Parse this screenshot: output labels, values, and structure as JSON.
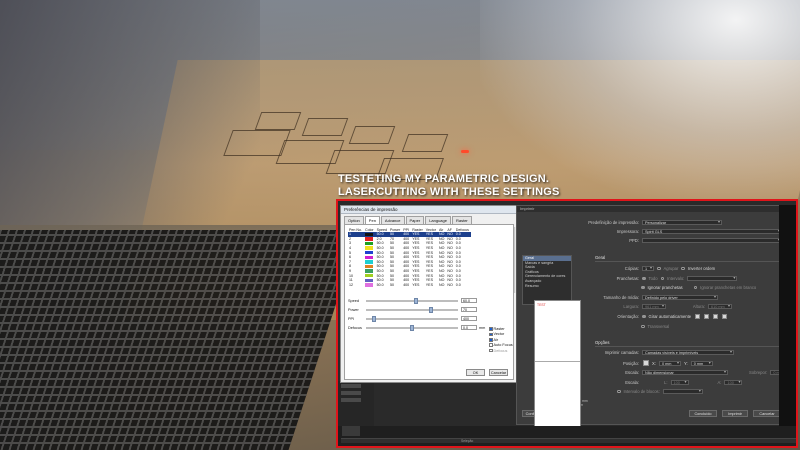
{
  "caption": {
    "line1": "TESTETING MY PARAMETRIC DESIGN.",
    "line2": "LASERCUTTING WITH THESE SETTINGS"
  },
  "prefs": {
    "title": "Preferências de impressão",
    "tabs": [
      "Option",
      "Pen",
      "Advance",
      "Paper",
      "Language",
      "Raster"
    ],
    "active_tab": "Pen",
    "columns": [
      "Pen No.",
      "Color",
      "Speed",
      "Power",
      "PPI",
      "Raster",
      "Vector",
      "Air",
      "AF",
      "Defocus"
    ],
    "pens": [
      {
        "no": "1",
        "color": "#111111",
        "speed": "50.0",
        "power": "50",
        "ppi": "400",
        "raster": "YES",
        "vector": "YES",
        "air": "NO",
        "af": "NO",
        "defocus": "0.0"
      },
      {
        "no": "2",
        "color": "#e02020",
        "speed": "2.0",
        "power": "70",
        "ppi": "400",
        "raster": "YES",
        "vector": "YES",
        "air": "NO",
        "af": "NO",
        "defocus": "0.0"
      },
      {
        "no": "3",
        "color": "#20a020",
        "speed": "50.0",
        "power": "50",
        "ppi": "400",
        "raster": "YES",
        "vector": "YES",
        "air": "NO",
        "af": "NO",
        "defocus": "0.0"
      },
      {
        "no": "4",
        "color": "#f0e020",
        "speed": "50.0",
        "power": "50",
        "ppi": "400",
        "raster": "YES",
        "vector": "YES",
        "air": "NO",
        "af": "NO",
        "defocus": "0.0"
      },
      {
        "no": "5",
        "color": "#2040d0",
        "speed": "50.0",
        "power": "50",
        "ppi": "400",
        "raster": "YES",
        "vector": "YES",
        "air": "NO",
        "af": "NO",
        "defocus": "0.0"
      },
      {
        "no": "6",
        "color": "#d020d0",
        "speed": "50.0",
        "power": "50",
        "ppi": "400",
        "raster": "YES",
        "vector": "YES",
        "air": "NO",
        "af": "NO",
        "defocus": "0.0"
      },
      {
        "no": "7",
        "color": "#20d0d0",
        "speed": "50.0",
        "power": "50",
        "ppi": "400",
        "raster": "YES",
        "vector": "YES",
        "air": "NO",
        "af": "NO",
        "defocus": "0.0"
      },
      {
        "no": "8",
        "color": "#e08020",
        "speed": "50.0",
        "power": "50",
        "ppi": "400",
        "raster": "YES",
        "vector": "YES",
        "air": "NO",
        "af": "NO",
        "defocus": "0.0"
      },
      {
        "no": "9",
        "color": "#3aa060",
        "speed": "50.0",
        "power": "50",
        "ppi": "400",
        "raster": "YES",
        "vector": "YES",
        "air": "NO",
        "af": "NO",
        "defocus": "0.0"
      },
      {
        "no": "10",
        "color": "#a0d020",
        "speed": "50.0",
        "power": "50",
        "ppi": "400",
        "raster": "YES",
        "vector": "YES",
        "air": "NO",
        "af": "NO",
        "defocus": "0.0"
      },
      {
        "no": "11",
        "color": "#6060c0",
        "speed": "50.0",
        "power": "50",
        "ppi": "400",
        "raster": "YES",
        "vector": "YES",
        "air": "NO",
        "af": "NO",
        "defocus": "0.0"
      },
      {
        "no": "12",
        "color": "#e070e0",
        "speed": "50.0",
        "power": "50",
        "ppi": "400",
        "raster": "YES",
        "vector": "YES",
        "air": "NO",
        "af": "NO",
        "defocus": "0.0"
      }
    ],
    "selected_pen": "1",
    "speed_label": "Speed",
    "speed_value": "60.0",
    "power_label": "Power",
    "power_value": "70",
    "ppi_label": "PPI",
    "ppi_value": "400",
    "defocus_label": "Defocus",
    "defocus_value": "0.0",
    "defocus_unit": "mm",
    "checks": [
      {
        "label": "Raster",
        "on": true
      },
      {
        "label": "Vector",
        "on": true
      },
      {
        "label": "Air",
        "on": true
      },
      {
        "label": "Auto Focus",
        "on": false
      },
      {
        "label": "Defocus",
        "on": false
      }
    ],
    "ok_label": "OK",
    "cancel_label": "Cancelar"
  },
  "print": {
    "title": "Imprimir",
    "preset_label": "Predefinição de impressão:",
    "preset_value": "Personalizar",
    "printer_label": "Impressora:",
    "printer_value": "Spirit GLS",
    "ppd_label": "PPD:",
    "categories": [
      "Geral",
      "Marcas e sangria",
      "Saída",
      "Gráficos",
      "Gerenciamento de cores",
      "Avançado",
      "Resumo"
    ],
    "active_category": "Geral",
    "section_geral": "Geral",
    "copies_label": "Cópias:",
    "copies_value": "1",
    "collate_label": "Agrupar",
    "reverse_label": "Inverter ordem",
    "artboards_label": "Pranchetas:",
    "all_label": "Todo",
    "interval_label": "Intervalo:",
    "ignore_artboards_label": "Ignorar pranchetas",
    "skip_blank_label": "Ignorar pranchetas em branco",
    "media_size_label": "Tamanho de mídia:",
    "media_size_value": "Definido pelo driver",
    "width_label": "Largura:",
    "width_value": "961 mm",
    "height_label": "Altura:",
    "height_value": "610 mm",
    "orientation_label": "Orientação:",
    "auto_rotate_label": "Girar automaticamente",
    "transverse_label": "Transversal",
    "section_options": "Opções",
    "print_layers_label": "Imprimir camadas:",
    "print_layers_value": "Camadas visíveis e imprimíveis",
    "position_label": "Posição:",
    "position_x_value": "0 mm",
    "position_y_value": "0 mm",
    "scaling_label": "Escala:",
    "scaling_value": "Não dimensionar",
    "overlap_label": "Sobrepor:",
    "overlap_value": "0 mm",
    "scale_label": "Escala:",
    "scale_w_value": "100",
    "scale_h_value": "100",
    "tile_range_label": "Intervalo de blocos:",
    "preview_tag": "TEST",
    "pager_value": "1 de 1",
    "doc_label": "Documento: 960 mm x 600 mm",
    "media_label": "Mídia: 961 mm x 960 mm",
    "setup_label": "Configurar...",
    "done_label": "Concluído",
    "print_label": "Imprimir",
    "cancel_label": "Cancelar"
  },
  "taskbar": {
    "status_label": "Seleção"
  }
}
